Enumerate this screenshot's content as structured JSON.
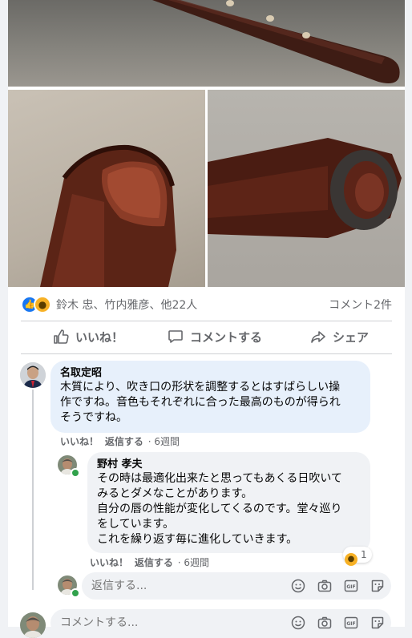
{
  "post": {
    "reaction_icons": [
      "like-icon",
      "wow-icon"
    ],
    "reactors": "鈴木 忠、竹内雅彦、他22人",
    "comment_count": "コメント2件"
  },
  "actions": {
    "like": "いいね！",
    "comment": "コメントする",
    "share": "シェア"
  },
  "comments": [
    {
      "author": "名取定昭",
      "text": "木質により、吹き口の形状を調整するとはすばらしい操\n作ですね。音色もそれぞれに合った最高のものが得られ\nそうですね。",
      "like": "いいね！",
      "reply": "返信する",
      "time": "· 6週間"
    },
    {
      "author": "野村 孝夫",
      "text": "その時は最適化出来たと思ってもあくる日吹いて\nみるとダメなことがあります。\n自分の唇の性能が変化してくるのです。堂々巡り\nをしています。\nこれを繰り返す毎に進化していきます。",
      "like": "いいね！",
      "reply": "返信する",
      "time": "· 6週間",
      "reaction_count": "1"
    }
  ],
  "reply_input": {
    "placeholder": "返信する..."
  },
  "comment_input": {
    "placeholder": "コメントする..."
  },
  "colors": {
    "accent": "#1877f2",
    "online": "#31a24c",
    "wow": "#f7b125"
  }
}
